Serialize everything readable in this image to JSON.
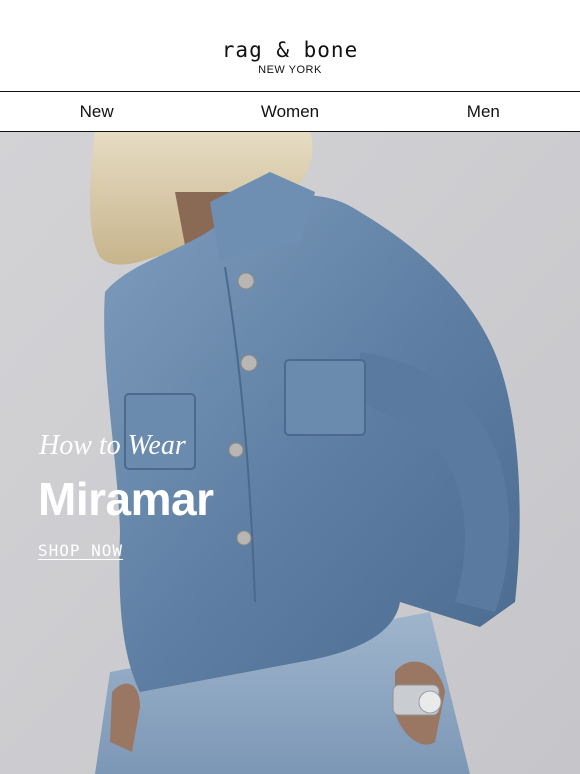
{
  "brand": {
    "logo": "rag & bone",
    "sublogo": "NEW YORK"
  },
  "nav": {
    "items": [
      "New",
      "Women",
      "Men"
    ]
  },
  "hero": {
    "kicker": "How to Wear",
    "headline": "Miramar",
    "cta": "SHOP NOW",
    "image_description_colors": {
      "denim": "#5f80a4",
      "wall": "#cfcfd2",
      "hair": "#d8c9a6"
    }
  }
}
